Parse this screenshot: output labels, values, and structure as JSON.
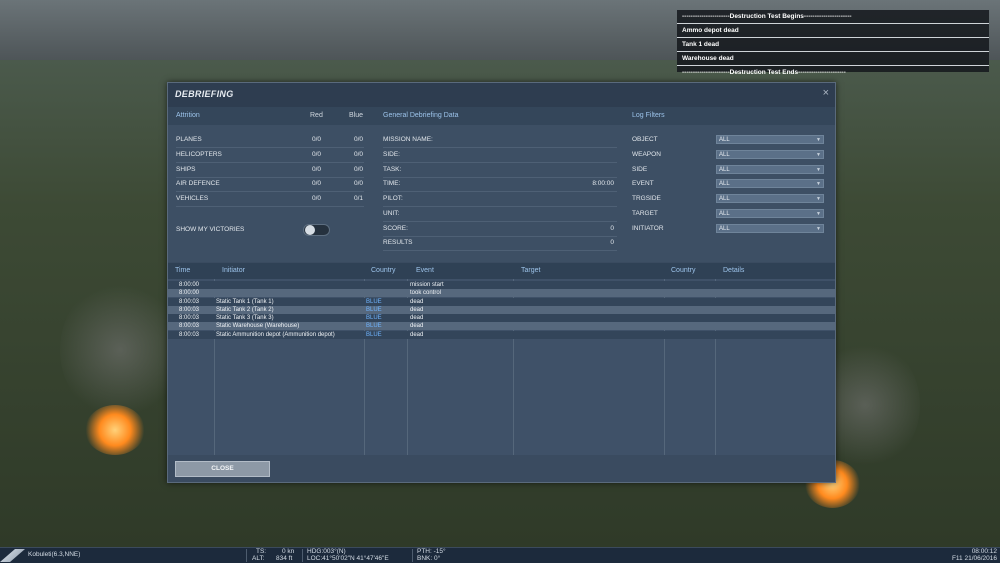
{
  "overlay_log": {
    "lines": [
      "----------------------Destruction Test Begins----------------------",
      "Ammo depot dead",
      "Tank 1 dead",
      "Warehouse dead",
      "----------------------Destruction Test Ends----------------------"
    ]
  },
  "dialog": {
    "title": "DEBRIEFING",
    "close_glyph": "×",
    "attrition": {
      "header": "Attrition",
      "col_red": "Red",
      "col_blue": "Blue",
      "rows": [
        {
          "label": "PLANES",
          "red": "0/0",
          "blue": "0/0"
        },
        {
          "label": "HELICOPTERS",
          "red": "0/0",
          "blue": "0/0"
        },
        {
          "label": "SHIPS",
          "red": "0/0",
          "blue": "0/0"
        },
        {
          "label": "AIR DEFENCE",
          "red": "0/0",
          "blue": "0/0"
        },
        {
          "label": "VEHICLES",
          "red": "0/0",
          "blue": "0/1"
        }
      ],
      "show_victories_label": "SHOW MY VICTORIES"
    },
    "general": {
      "header": "General Debriefing Data",
      "rows": [
        {
          "label": "MISSION NAME:",
          "value": ""
        },
        {
          "label": "SIDE:",
          "value": ""
        },
        {
          "label": "TASK:",
          "value": ""
        },
        {
          "label": "TIME:",
          "value": "8:00:00"
        },
        {
          "label": "PILOT:",
          "value": ""
        },
        {
          "label": "UNIT:",
          "value": ""
        },
        {
          "label": "SCORE:",
          "value": "0"
        },
        {
          "label": "RESULTS",
          "value": "0"
        }
      ]
    },
    "filters": {
      "header": "Log Filters",
      "rows": [
        {
          "label": "OBJECT",
          "value": "ALL"
        },
        {
          "label": "WEAPON",
          "value": "ALL"
        },
        {
          "label": "SIDE",
          "value": "ALL"
        },
        {
          "label": "EVENT",
          "value": "ALL"
        },
        {
          "label": "TRGSIDE",
          "value": "ALL"
        },
        {
          "label": "TARGET",
          "value": "ALL"
        },
        {
          "label": "INITIATOR",
          "value": "ALL"
        }
      ],
      "arrow": "▼"
    },
    "log_table": {
      "columns": [
        "Time",
        "Initiator",
        "Country",
        "Event",
        "Target",
        "Country",
        "Details"
      ],
      "rows": [
        {
          "time": "8:00:00",
          "initiator": "",
          "country": "",
          "event": "mission start"
        },
        {
          "time": "8:00:00",
          "initiator": "",
          "country": "",
          "event": "took control"
        },
        {
          "time": "8:00:03",
          "initiator": "Static Tank 1 (Tank 1)",
          "country": "BLUE",
          "event": "dead"
        },
        {
          "time": "8:00:03",
          "initiator": "Static Tank 2 (Tank 2)",
          "country": "BLUE",
          "event": "dead"
        },
        {
          "time": "8:00:03",
          "initiator": "Static Tank 3 (Tank 3)",
          "country": "BLUE",
          "event": "dead"
        },
        {
          "time": "8:00:03",
          "initiator": "Static Warehouse (Warehouse)",
          "country": "BLUE",
          "event": "dead"
        },
        {
          "time": "8:00:03",
          "initiator": "Static Ammunition depot (Ammunition depot)",
          "country": "BLUE",
          "event": "dead"
        }
      ]
    },
    "close_button": "CLOSE"
  },
  "statusbar": {
    "location": "Kobuleti(6.3,NNE)",
    "ts_label": "TS:",
    "ts_value": "0 kn",
    "alt_label": "ALT:",
    "alt_value": "834 ft",
    "hdg": "HDG:003°(N)",
    "loc": "LOC:41°50'02\"N 41°47'46\"E",
    "pth": "PTH: -15°",
    "bnk": "BNK: 0°",
    "time": "08:00:12",
    "date": "F11 21/06/2016"
  }
}
